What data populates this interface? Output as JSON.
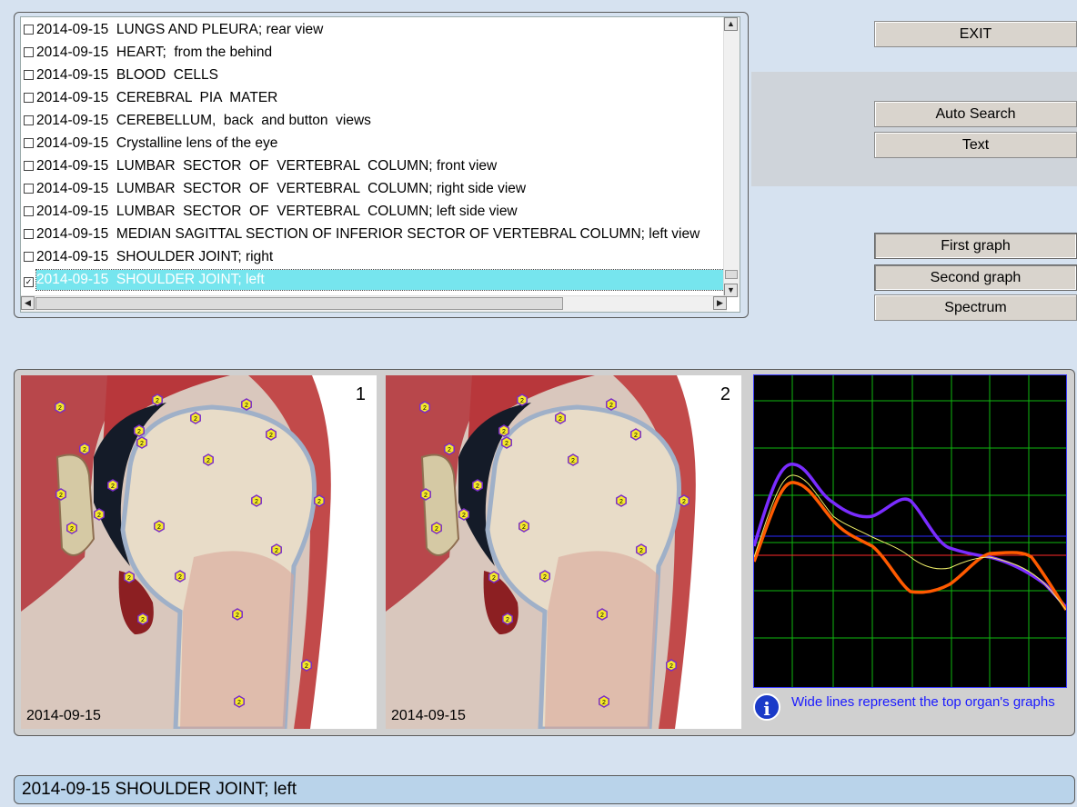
{
  "list": {
    "items": [
      {
        "date": "2014-09-15",
        "label": "LUNGS AND PLEURA; rear view",
        "checked": false
      },
      {
        "date": "2014-09-15",
        "label": "HEART;  from the behind",
        "checked": false
      },
      {
        "date": "2014-09-15",
        "label": "BLOOD  CELLS",
        "checked": false
      },
      {
        "date": "2014-09-15",
        "label": "CEREBRAL  PIA  MATER",
        "checked": false
      },
      {
        "date": "2014-09-15",
        "label": "CEREBELLUM,  back  and button  views",
        "checked": false
      },
      {
        "date": "2014-09-15",
        "label": "Crystalline lens of the eye",
        "checked": false
      },
      {
        "date": "2014-09-15",
        "label": "LUMBAR  SECTOR  OF  VERTEBRAL  COLUMN; front view",
        "checked": false
      },
      {
        "date": "2014-09-15",
        "label": "LUMBAR  SECTOR  OF  VERTEBRAL  COLUMN; right side view",
        "checked": false
      },
      {
        "date": "2014-09-15",
        "label": "LUMBAR  SECTOR  OF  VERTEBRAL  COLUMN; left side view",
        "checked": false
      },
      {
        "date": "2014-09-15",
        "label": "MEDIAN SAGITTAL SECTION OF INFERIOR SECTOR OF VERTEBRAL COLUMN; left view",
        "checked": false
      },
      {
        "date": "2014-09-15",
        "label": "SHOULDER JOINT; right",
        "checked": false
      },
      {
        "date": "2014-09-15",
        "label": "SHOULDER JOINT; left",
        "checked": true
      }
    ]
  },
  "buttons": {
    "exit": "EXIT",
    "auto_search": "Auto Search",
    "text": "Text",
    "first_graph": "First graph",
    "second_graph": "Second graph",
    "spectrum": "Spectrum"
  },
  "scans": [
    {
      "number": "1",
      "date": "2014-09-15"
    },
    {
      "number": "2",
      "date": "2014-09-15"
    }
  ],
  "markers": {
    "label": "2"
  },
  "info": {
    "text": "Wide lines represent the top organ's graphs"
  },
  "status": {
    "text": "2014-09-15 SHOULDER JOINT; left"
  },
  "colors": {
    "selection": "#76e5ee",
    "graph_bg": "#000000",
    "grid": "#0fb80f",
    "purple_line": "#7a2cff",
    "orange_line": "#ff5a00",
    "yellow_line": "#f0f06a"
  }
}
